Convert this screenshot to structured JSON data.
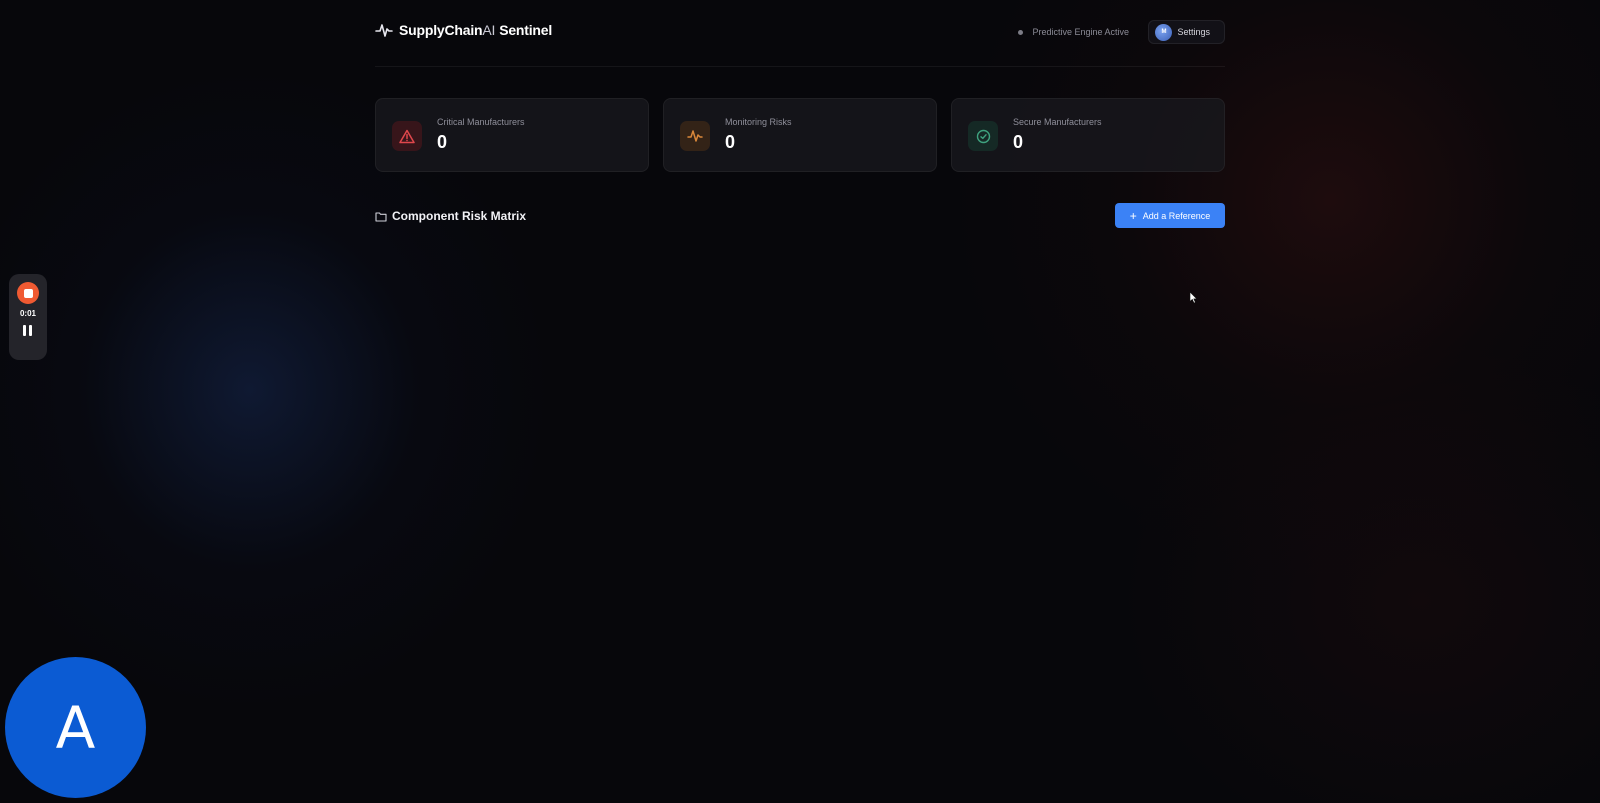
{
  "header": {
    "brand_supply": "SupplyChain",
    "brand_ai": "AI",
    "brand_sentinel": "Sentinel",
    "engine_status": "Predictive Engine Active",
    "settings_label": "Settings",
    "settings_avatar_initial": "M"
  },
  "stats": [
    {
      "label": "Critical Manufacturers",
      "value": "0",
      "icon": "alert-triangle-icon",
      "color": "#e0474c"
    },
    {
      "label": "Monitoring Risks",
      "value": "0",
      "icon": "activity-icon",
      "color": "#d9873a"
    },
    {
      "label": "Secure Manufacturers",
      "value": "0",
      "icon": "check-circle-icon",
      "color": "#3fa37f"
    }
  ],
  "section": {
    "title": "Component Risk Matrix",
    "add_button_label": "Add a Reference"
  },
  "recorder": {
    "time": "0:01"
  },
  "user_avatar": {
    "initial": "A"
  },
  "colors": {
    "accent": "#3b82f6",
    "background": "#07070b",
    "recorder_stop": "#f05a32",
    "avatar": "#0b5bd3"
  }
}
